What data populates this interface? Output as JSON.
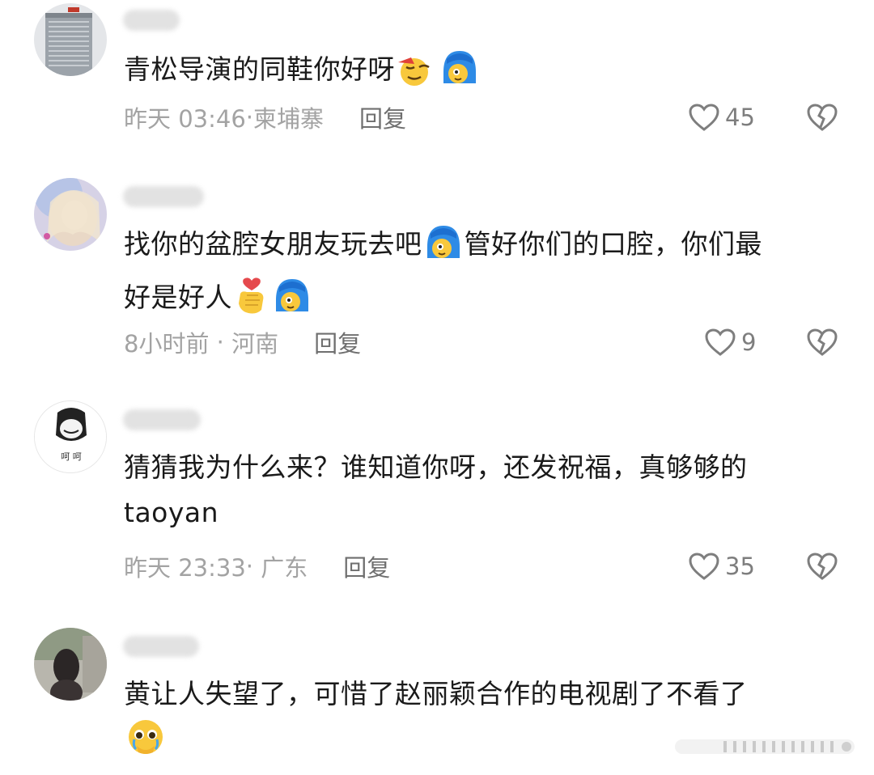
{
  "comments": [
    {
      "text": "青松导演的同鞋你好呀",
      "time": "昨天 03:46",
      "location": "柬埔寨",
      "reply": "回复",
      "likes": "45",
      "emojis": [
        "squint-face-emoji",
        "blue-hair-face-emoji"
      ]
    },
    {
      "text_part1": "找你的盆腔女朋友玩去吧",
      "text_part2": "管好你们的口腔，你们最",
      "text_part3": "好是好人",
      "time": "8小时前",
      "location": "河南",
      "reply": "回复",
      "likes": "9",
      "emojis": [
        "blue-hair-face-emoji",
        "finger-heart-emoji",
        "blue-hair-face-emoji"
      ]
    },
    {
      "text_line1": "猜猜我为什么来？谁知道你呀，还发祝福，真够够的",
      "text_line2": "taoyan",
      "time": "昨天 23:33",
      "location": "广东",
      "reply": "回复",
      "likes": "35",
      "avatar_text": "呵 呵"
    },
    {
      "text": "黄让人失望了，可惜了赵丽颖合作的电视剧了不看了",
      "emojis": [
        "pleading-face-emoji"
      ]
    }
  ],
  "colors": {
    "text": "#1a1a1a",
    "meta": "#a3a3a3",
    "icon": "#7e7e7e"
  }
}
